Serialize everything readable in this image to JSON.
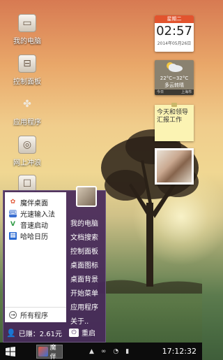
{
  "desktop_icons": [
    {
      "label": "我的电脑",
      "icon": "computer-icon"
    },
    {
      "label": "控制面板",
      "icon": "control-panel-icon"
    },
    {
      "label": "应用程序",
      "icon": "apps-icon"
    },
    {
      "label": "网上冲浪",
      "icon": "browser-icon"
    }
  ],
  "widgets": {
    "clock": {
      "weekday": "星期二",
      "time": "02:57",
      "date": "2014年05月26日"
    },
    "weather": {
      "temp": "22°C~32°C",
      "condition": "多云转晴",
      "left": "今日",
      "right": "上海市"
    },
    "note": {
      "text": "今天和领导汇报工作"
    }
  },
  "start_menu": {
    "apps": [
      {
        "label": "魔伴桌面",
        "icon": "mobang-icon",
        "color": "#e25a3a"
      },
      {
        "label": "光速输入法",
        "icon": "keyboard-icon",
        "color": "#3b6fd1"
      },
      {
        "label": "音速启动",
        "icon": "v-icon",
        "color": "#2e9a44"
      },
      {
        "label": "哈哈日历",
        "icon": "calendar-icon",
        "color": "#2a6ad3"
      }
    ],
    "all_programs": "所有程序",
    "right_items": [
      "我的电脑",
      "文档搜索",
      "控制面板",
      "桌面图标",
      "桌面背景",
      "开始菜单",
      "应用程序",
      "关于.."
    ],
    "earnings": "已赚：2.61元",
    "restart": "重启"
  },
  "taskbar": {
    "app_label": "魔伴",
    "clock": "17:12:32"
  }
}
